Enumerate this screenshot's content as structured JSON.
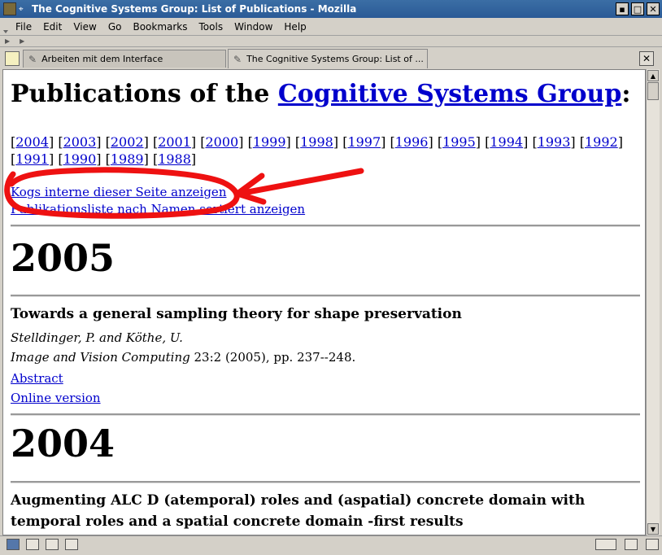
{
  "window": {
    "title": "The Cognitive Systems Group: List of Publications - Mozilla",
    "pin_glyph": "⌖",
    "minimize_glyph": "▪",
    "maximize_glyph": "□",
    "close_glyph": "✕"
  },
  "menu": [
    "File",
    "Edit",
    "View",
    "Go",
    "Bookmarks",
    "Tools",
    "Window",
    "Help"
  ],
  "tabs": [
    {
      "label": "Arbeiten mit dem Interface",
      "active": false
    },
    {
      "label": "The Cognitive Systems Group: List of ...",
      "active": true
    }
  ],
  "page": {
    "heading_prefix": "Publications of the ",
    "heading_link": "Cognitive Systems Group",
    "heading_suffix": ":",
    "years": [
      "2004",
      "2003",
      "2002",
      "2001",
      "2000",
      "1999",
      "1998",
      "1997",
      "1996",
      "1995",
      "1994",
      "1993",
      "1992",
      "1991",
      "1990",
      "1989",
      "1988"
    ],
    "logs_link": "Kogs interne dieser Seite anzeigen",
    "sorted_link": "Publikationsliste nach Namen sortiert anzeigen",
    "sections": [
      {
        "year": "2005",
        "entries": [
          {
            "title": "Towards a general sampling theory for shape preservation",
            "authors": "Stelldinger, P. and Köthe, U.",
            "journal": "Image and Vision Computing",
            "details": " 23:2 (2005), pp. 237--248.",
            "links": [
              "Abstract",
              "Online version"
            ]
          }
        ]
      },
      {
        "year": "2004",
        "entries": [
          {
            "title": "Augmenting ALC D (atemporal) roles and (aspatial) concrete domain with temporal roles and a spatial concrete domain -first results"
          }
        ]
      }
    ]
  },
  "colors": {
    "link": "#0000cc",
    "annotation": "#ee1111",
    "titlebar": "#3b6ea5"
  }
}
